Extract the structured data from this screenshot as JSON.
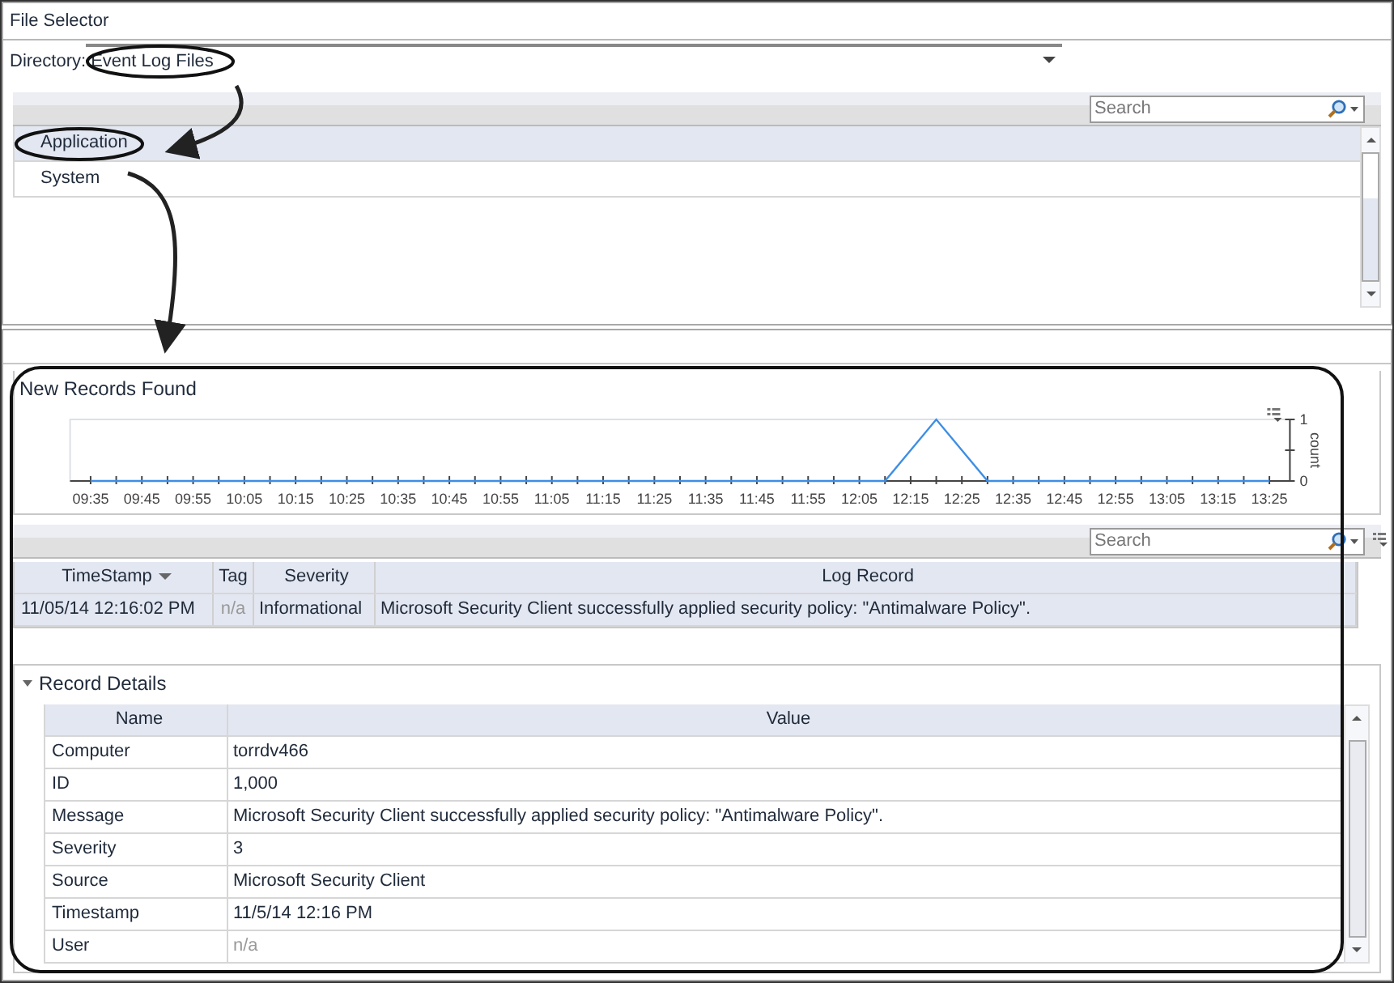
{
  "file_selector": {
    "title": "File Selector",
    "directory_label": "Directory:",
    "directory_value": "Event Log Files",
    "search": {
      "placeholder": "Search"
    },
    "items": [
      {
        "label": "Application",
        "selected": true
      },
      {
        "label": "System",
        "selected": false
      }
    ]
  },
  "new_records": {
    "title": "New Records Found",
    "chart_data": {
      "type": "line",
      "ylabel": "count",
      "ylim": [
        0,
        1
      ],
      "yticks": [
        0,
        1
      ],
      "xlim": [
        571,
        809
      ],
      "x": [
        575,
        730,
        740,
        750,
        805
      ],
      "series": [
        {
          "color": "#3d8ee6",
          "values": [
            0,
            0,
            1,
            0,
            0
          ]
        }
      ],
      "xticks": [
        {
          "value": 575,
          "label": "09:35"
        },
        {
          "value": 585,
          "label": "09:45"
        },
        {
          "value": 595,
          "label": "09:55"
        },
        {
          "value": 605,
          "label": "10:05"
        },
        {
          "value": 615,
          "label": "10:15"
        },
        {
          "value": 625,
          "label": "10:25"
        },
        {
          "value": 635,
          "label": "10:35"
        },
        {
          "value": 645,
          "label": "10:45"
        },
        {
          "value": 655,
          "label": "10:55"
        },
        {
          "value": 665,
          "label": "11:05"
        },
        {
          "value": 675,
          "label": "11:15"
        },
        {
          "value": 685,
          "label": "11:25"
        },
        {
          "value": 695,
          "label": "11:35"
        },
        {
          "value": 705,
          "label": "11:45"
        },
        {
          "value": 715,
          "label": "11:55"
        },
        {
          "value": 725,
          "label": "12:05"
        },
        {
          "value": 735,
          "label": "12:15"
        },
        {
          "value": 745,
          "label": "12:25"
        },
        {
          "value": 755,
          "label": "12:35"
        },
        {
          "value": 765,
          "label": "12:45"
        },
        {
          "value": 775,
          "label": "12:55"
        },
        {
          "value": 785,
          "label": "13:05"
        },
        {
          "value": 795,
          "label": "13:15"
        },
        {
          "value": 805,
          "label": "13:25"
        }
      ]
    }
  },
  "records": {
    "search": {
      "placeholder": "Search"
    },
    "columns": [
      {
        "label": "TimeStamp",
        "sorted": true
      },
      {
        "label": "Tag",
        "sorted": false
      },
      {
        "label": "Severity",
        "sorted": false
      },
      {
        "label": "Log Record",
        "sorted": false
      }
    ],
    "rows": [
      {
        "selected": true,
        "cells": [
          {
            "text": "11/05/14 12:16:02 PM",
            "muted": false
          },
          {
            "text": "n/a",
            "muted": true
          },
          {
            "text": "Informational",
            "muted": false
          },
          {
            "text": "Microsoft Security Client successfully applied security policy: \"Antimalware Policy\".",
            "muted": false
          }
        ]
      }
    ]
  },
  "details": {
    "title": "Record Details",
    "expanded": true,
    "columns": [
      "Name",
      "Value"
    ],
    "rows": [
      {
        "name": "Computer",
        "value": "torrdv466",
        "muted": false
      },
      {
        "name": "ID",
        "value": "1,000",
        "muted": false
      },
      {
        "name": "Message",
        "value": "Microsoft Security Client successfully applied security policy: \"Antimalware Policy\".",
        "muted": false
      },
      {
        "name": "Severity",
        "value": "3",
        "muted": false
      },
      {
        "name": "Source",
        "value": "Microsoft Security Client",
        "muted": false
      },
      {
        "name": "Timestamp",
        "value": "11/5/14 12:16 PM",
        "muted": false
      },
      {
        "name": "User",
        "value": "n/a",
        "muted": true
      }
    ]
  }
}
